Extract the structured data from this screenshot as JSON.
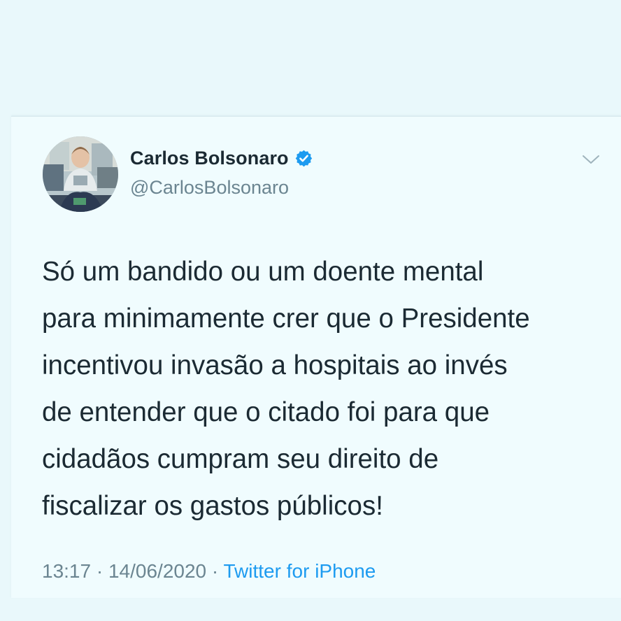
{
  "tweet": {
    "author_name": "Carlos Bolsonaro",
    "author_handle": "@CarlosBolsonaro",
    "verified": true,
    "verified_icon": "verified-badge-icon",
    "menu_icon": "chevron-down-icon",
    "text_lines": [
      "Só um bandido ou um doente mental",
      "para minimamente crer que o Presidente",
      "incentivou invasão a hospitais ao invés",
      "de entender que o citado foi para que",
      "cidadãos cumpram seu direito de",
      "fiscalizar os gastos públicos!"
    ],
    "time": "13:17",
    "separator": "·",
    "date": "14/06/2020",
    "source": "Twitter for iPhone"
  },
  "colors": {
    "background": "#e9f8fb",
    "card": "#f0fcfe",
    "text": "#1b2a33",
    "muted": "#6b8591",
    "link": "#1d9bf0"
  }
}
